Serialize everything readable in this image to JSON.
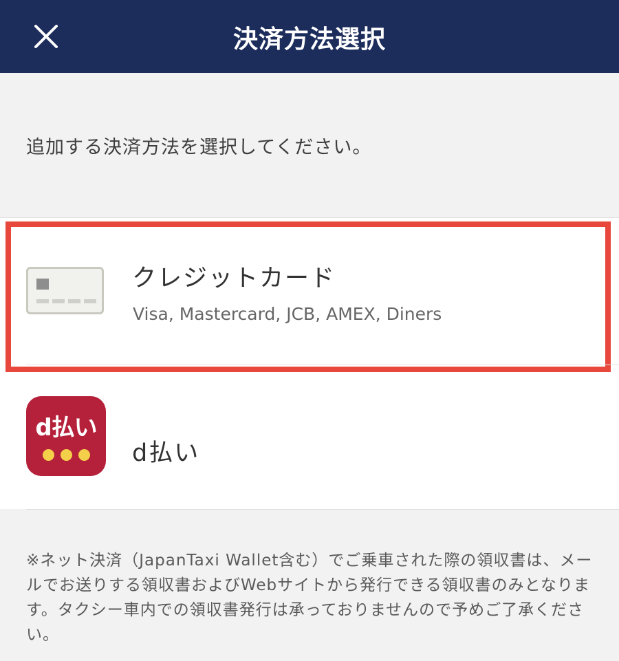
{
  "header": {
    "title": "決済方法選択",
    "close_icon": "close-icon",
    "background_color": "#1c2d5c"
  },
  "prompt": "追加する決済方法を選択してください。",
  "methods": [
    {
      "title": "クレジットカード",
      "subtitle": "Visa, Mastercard, JCB, AMEX, Diners",
      "icon": "credit-card-icon",
      "highlighted": true,
      "highlight_color": "#e8473b"
    },
    {
      "title": "d払い",
      "icon": "d-payment-logo",
      "logo_text": "d払い",
      "logo_color": "#b5213a"
    }
  ],
  "note": "※ネット決済（JapanTaxi Wallet含む）でご乗車された際の領収書は、メールでお送りする領収書およびWebサイトから発行できる領収書のみとなります。タクシー車内での領収書発行は承っておりませんので予めご了承ください。"
}
